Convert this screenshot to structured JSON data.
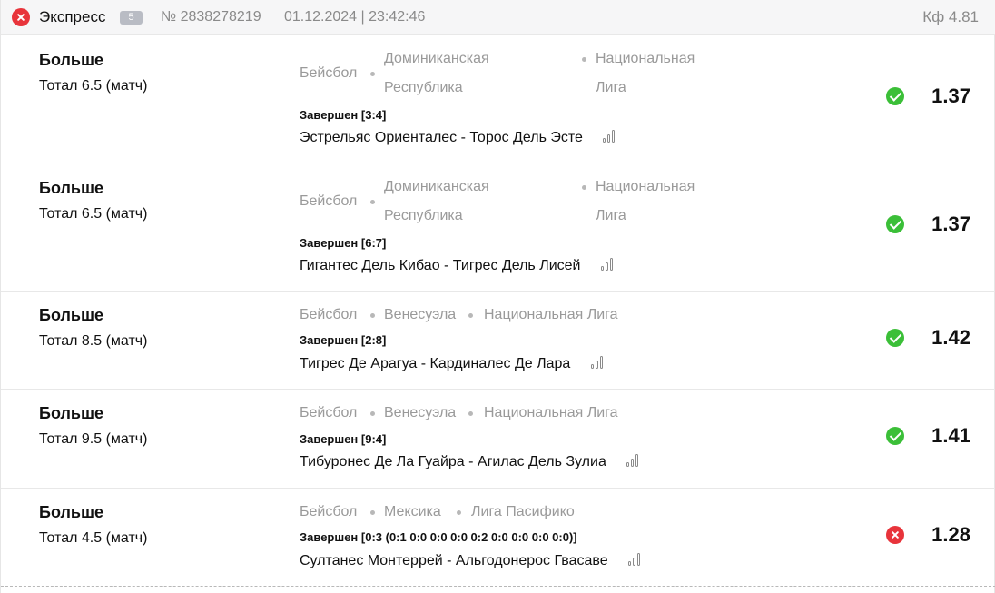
{
  "header": {
    "title": "Экспресс",
    "count": "5",
    "number": "№ 2838278219",
    "datetime": "01.12.2024 | 23:42:46",
    "coef": "Кф 4.81",
    "status": "lost"
  },
  "colors": {
    "win": "#3bbf38",
    "lose": "#e8343b",
    "muted": "#9a9a9a"
  },
  "bets": [
    {
      "name": "Больше",
      "market": "Тотал 6.5 (матч)",
      "sport": "Бейсбол",
      "country_line1": "Доминиканская",
      "country_line2": "Республика",
      "league_line1": "Национальная",
      "league_line2": "Лига",
      "status": "Завершен [3:4]",
      "teams": "Эстрельяс Ориенталес - Торос Дель Эсте",
      "result": "win",
      "odds": "1.37"
    },
    {
      "name": "Больше",
      "market": "Тотал 6.5 (матч)",
      "sport": "Бейсбол",
      "country_line1": "Доминиканская",
      "country_line2": "Республика",
      "league_line1": "Национальная",
      "league_line2": "Лига",
      "status": "Завершен [6:7]",
      "teams": "Гигантес Дель Кибао - Тигрес Дель Лисей",
      "result": "win",
      "odds": "1.37"
    },
    {
      "name": "Больше",
      "market": "Тотал 8.5 (матч)",
      "sport": "Бейсбол",
      "country": "Венесуэла",
      "league": "Национальная Лига",
      "status": "Завершен [2:8]",
      "teams": "Тигрес Де Арагуа - Кардиналес Де Лара",
      "result": "win",
      "odds": "1.42"
    },
    {
      "name": "Больше",
      "market": "Тотал 9.5 (матч)",
      "sport": "Бейсбол",
      "country": "Венесуэла",
      "league": "Национальная Лига",
      "status": "Завершен [9:4]",
      "teams": "Тибуронес Де Ла Гуайра - Агилас Дель Зулиа",
      "result": "win",
      "odds": "1.41"
    },
    {
      "name": "Больше",
      "market": "Тотал 4.5 (матч)",
      "sport": "Бейсбол",
      "country": "Мексика",
      "league": "Лига Пасифико",
      "status": "Завершен [0:3 (0:1 0:0 0:0 0:0 0:2 0:0 0:0 0:0 0:0)]",
      "teams": "Султанес Монтеррей - Альгодонерос Гвасаве",
      "result": "lose",
      "odds": "1.28"
    }
  ]
}
